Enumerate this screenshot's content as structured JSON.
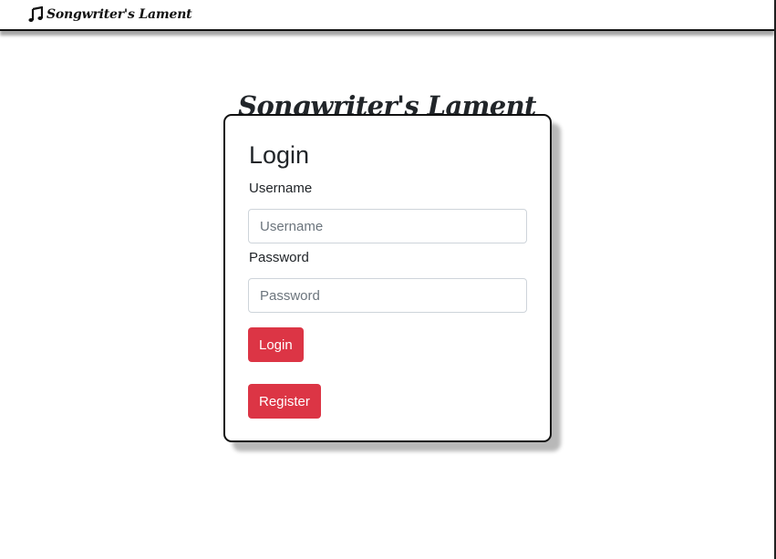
{
  "navbar": {
    "brand_label": "Songwriter's Lament",
    "brand_icon": "music-note-icon"
  },
  "page": {
    "title": "Songwriter's Lament"
  },
  "login": {
    "heading": "Login",
    "username_label": "Username",
    "username_placeholder": "Username",
    "username_value": "",
    "password_label": "Password",
    "password_placeholder": "Password",
    "password_value": "",
    "login_button": "Login",
    "register_button": "Register"
  },
  "colors": {
    "button_bg": "#dc3545",
    "button_text": "#ffffff",
    "text": "#212529",
    "input_border": "#ced4da"
  }
}
